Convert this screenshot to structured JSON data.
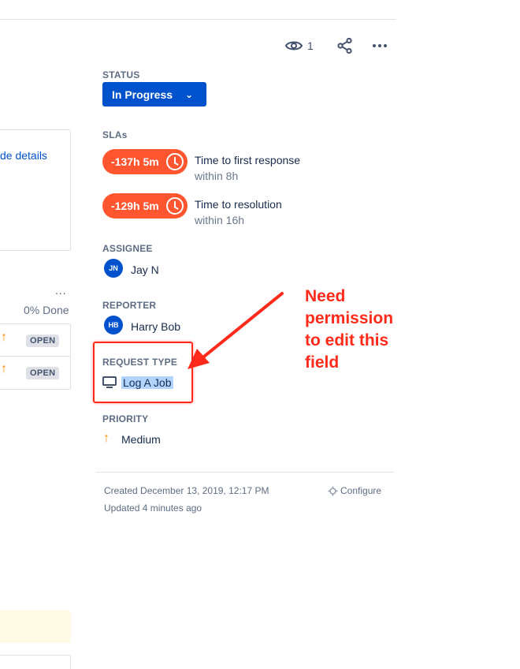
{
  "left_panel": {
    "details_link": "de details",
    "more_dots": "...",
    "progress": "0% Done",
    "rows": [
      {
        "status": "OPEN"
      },
      {
        "status": "OPEN"
      }
    ]
  },
  "header": {
    "watch_count": "1"
  },
  "status": {
    "label": "STATUS",
    "value": "In Progress"
  },
  "slas": {
    "label": "SLAs",
    "items": [
      {
        "time": "-137h 5m",
        "name": "Time to first response",
        "target": "within 8h"
      },
      {
        "time": "-129h 5m",
        "name": "Time to resolution",
        "target": "within 16h"
      }
    ]
  },
  "assignee": {
    "label": "ASSIGNEE",
    "initials": "JN",
    "name": "Jay N"
  },
  "reporter": {
    "label": "REPORTER",
    "initials": "HB",
    "name": "Harry Bob"
  },
  "request_type": {
    "label": "REQUEST TYPE",
    "value": "Log A Job"
  },
  "priority": {
    "label": "PRIORITY",
    "value": "Medium"
  },
  "footer": {
    "created": "Created December 13, 2019, 12:17 PM",
    "updated": "Updated 4 minutes ago",
    "configure": "Configure"
  },
  "annotation": {
    "lines": [
      "Need",
      "permission",
      "to edit this",
      "field"
    ]
  },
  "colors": {
    "primary": "#0052cc",
    "sla_breached": "#ff5630",
    "annotation": "#ff2a1a",
    "priority_medium": "#ff8b00"
  }
}
